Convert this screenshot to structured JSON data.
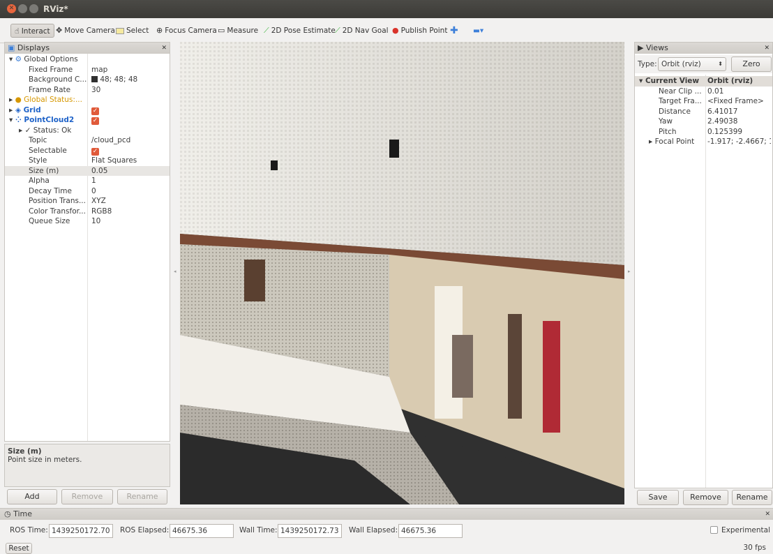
{
  "window": {
    "title": "RViz*"
  },
  "toolbar": {
    "interact": "Interact",
    "move_camera": "Move Camera",
    "select": "Select",
    "focus_camera": "Focus Camera",
    "measure": "Measure",
    "pose_estimate": "2D Pose Estimate",
    "nav_goal": "2D Nav Goal",
    "publish_point": "Publish Point"
  },
  "displays": {
    "title": "Displays",
    "rows": [
      {
        "key": "Global Options",
        "value": ""
      },
      {
        "key": "Fixed Frame",
        "value": "map"
      },
      {
        "key": "Background C...",
        "value": "48; 48; 48"
      },
      {
        "key": "Frame Rate",
        "value": "30"
      },
      {
        "key": "Global Status:...",
        "value": ""
      },
      {
        "key": "Grid",
        "value": ""
      },
      {
        "key": "PointCloud2",
        "value": ""
      },
      {
        "key": "Status: Ok",
        "value": ""
      },
      {
        "key": "Topic",
        "value": "/cloud_pcd"
      },
      {
        "key": "Selectable",
        "value": ""
      },
      {
        "key": "Style",
        "value": "Flat Squares"
      },
      {
        "key": "Size (m)",
        "value": "0.05"
      },
      {
        "key": "Alpha",
        "value": "1"
      },
      {
        "key": "Decay Time",
        "value": "0"
      },
      {
        "key": "Position Trans...",
        "value": "XYZ"
      },
      {
        "key": "Color Transfor...",
        "value": "RGB8"
      },
      {
        "key": "Queue Size",
        "value": "10"
      }
    ],
    "desc_title": "Size (m)",
    "desc_text": "Point size in meters.",
    "add": "Add",
    "remove": "Remove",
    "rename": "Rename"
  },
  "views": {
    "title": "Views",
    "type_label": "Type:",
    "type_value": "Orbit (rviz)",
    "zero": "Zero",
    "rows": [
      {
        "key": "Current View",
        "value": "Orbit (rviz)"
      },
      {
        "key": "Near Clip ...",
        "value": "0.01"
      },
      {
        "key": "Target Fra...",
        "value": "<Fixed Frame>"
      },
      {
        "key": "Distance",
        "value": "6.41017"
      },
      {
        "key": "Yaw",
        "value": "2.49038"
      },
      {
        "key": "Pitch",
        "value": "0.125399"
      },
      {
        "key": "Focal Point",
        "value": "-1.917; -2.4667; 1..."
      }
    ],
    "save": "Save",
    "remove": "Remove",
    "rename": "Rename"
  },
  "time": {
    "title": "Time",
    "ros_time_label": "ROS Time:",
    "ros_time": "1439250172.70",
    "ros_elapsed_label": "ROS Elapsed:",
    "ros_elapsed": "46675.36",
    "wall_time_label": "Wall Time:",
    "wall_time": "1439250172.73",
    "wall_elapsed_label": "Wall Elapsed:",
    "wall_elapsed": "46675.36",
    "experimental": "Experimental",
    "reset": "Reset",
    "fps": "30 fps"
  },
  "colors": {
    "background_swatch": "#303030",
    "accent": "#e05a3a",
    "link": "#1e62c8"
  }
}
